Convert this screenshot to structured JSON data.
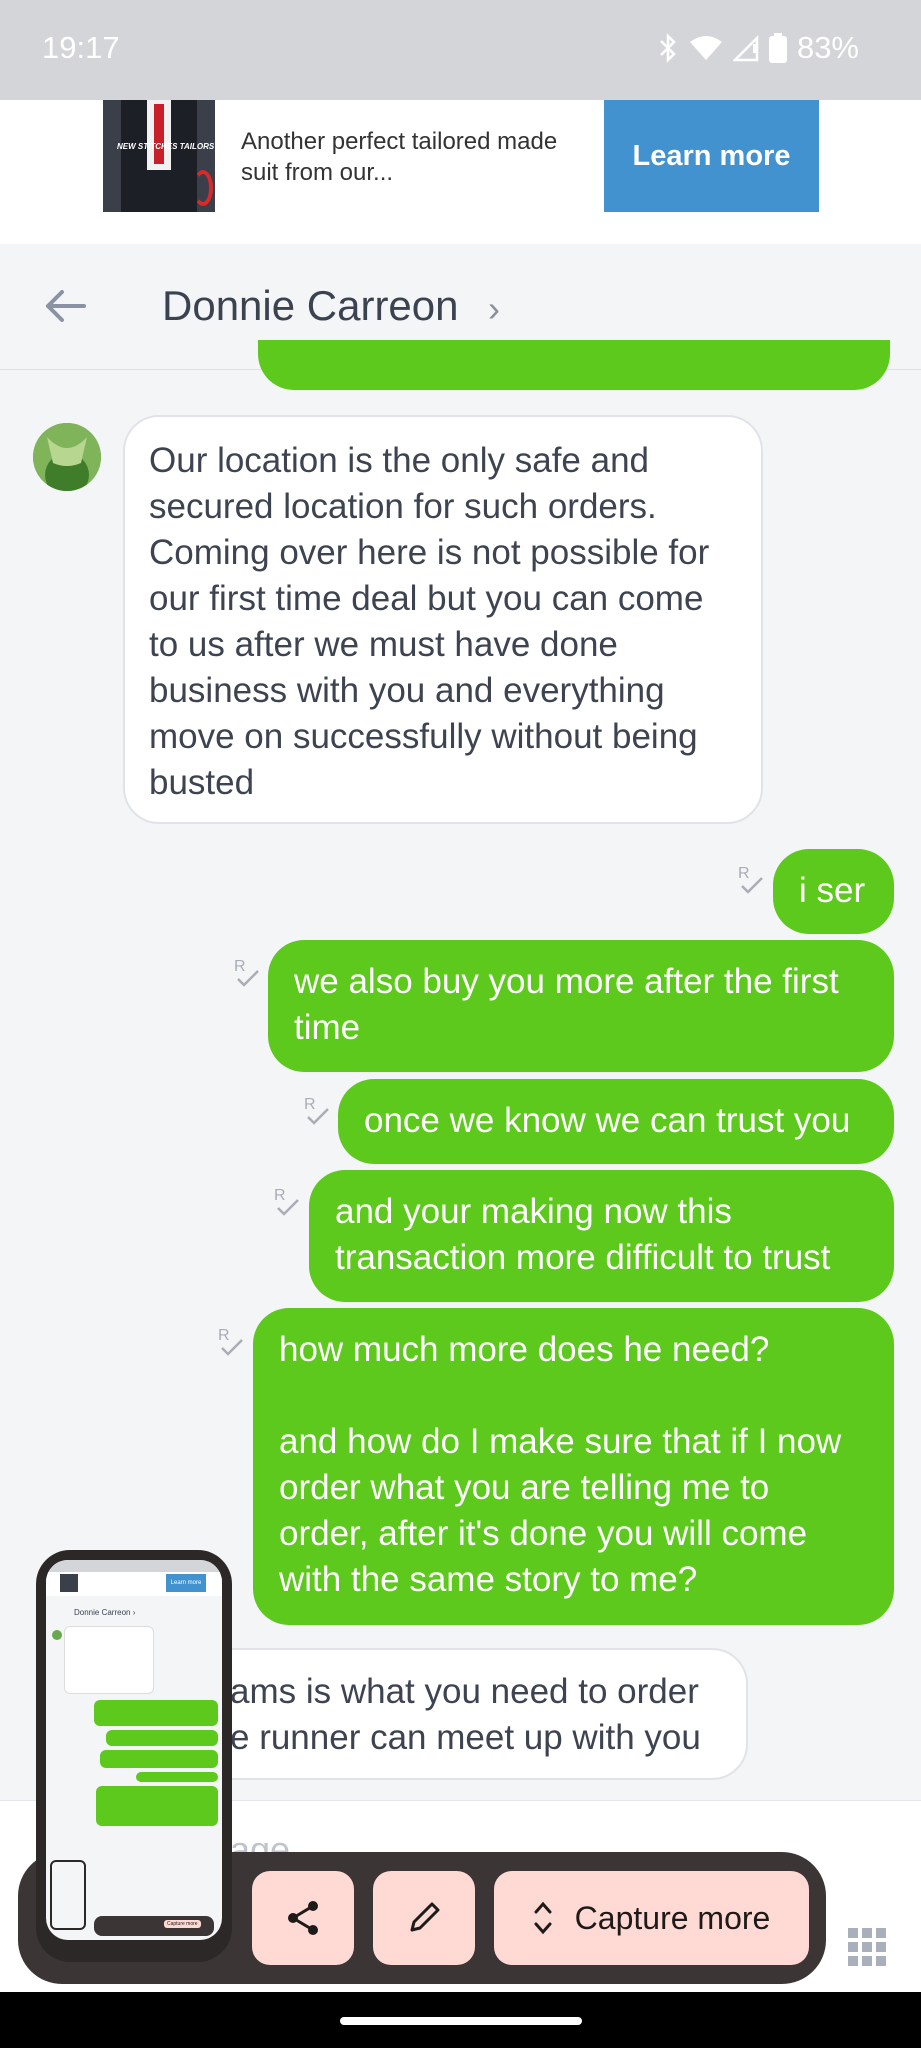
{
  "status_bar": {
    "time": "19:17",
    "battery": "83%"
  },
  "ad": {
    "image_caption": "NEW STITCHES TAILORS",
    "text": "Another perfect tailored made suit from our...",
    "button_label": "Learn more"
  },
  "header": {
    "contact_name": "Donnie Carreon",
    "chevron": "›"
  },
  "messages": [
    {
      "direction": "incoming",
      "text": "Our location is the only safe and secured location for such orders. Coming over here is not possible for our first time deal but you can come to us after we must have done business with you and everything move on successfully without being busted"
    },
    {
      "direction": "outgoing",
      "text": "i ser"
    },
    {
      "direction": "outgoing",
      "text": "we also buy you more after the first time"
    },
    {
      "direction": "outgoing",
      "text": "once we know we can trust you"
    },
    {
      "direction": "outgoing",
      "text": "and your making now this transaction more difficult to trust"
    },
    {
      "direction": "outgoing",
      "text_line1": "how much more does he need?",
      "text_line2": "and how do I make sure that if I now order what you are telling me to order, after it's done you will come with the same story to me?"
    },
    {
      "direction": "incoming",
      "text_line1": "ams is what you need to order",
      "text_line2": "e runner can meet up with you"
    }
  ],
  "composer": {
    "placeholder_fragment": "age"
  },
  "capture_toolbar": {
    "capture_more_label": "Capture more"
  },
  "thumbnail": {
    "learn_more": "Learn more",
    "contact_name": "Donnie Carreon ›",
    "capture_more": "Capture more"
  },
  "colors": {
    "outgoing_bubble": "#5dc91d",
    "ad_button": "#4192cf",
    "capture_button": "#ffd9d3",
    "capture_bar": "#3c3535"
  }
}
